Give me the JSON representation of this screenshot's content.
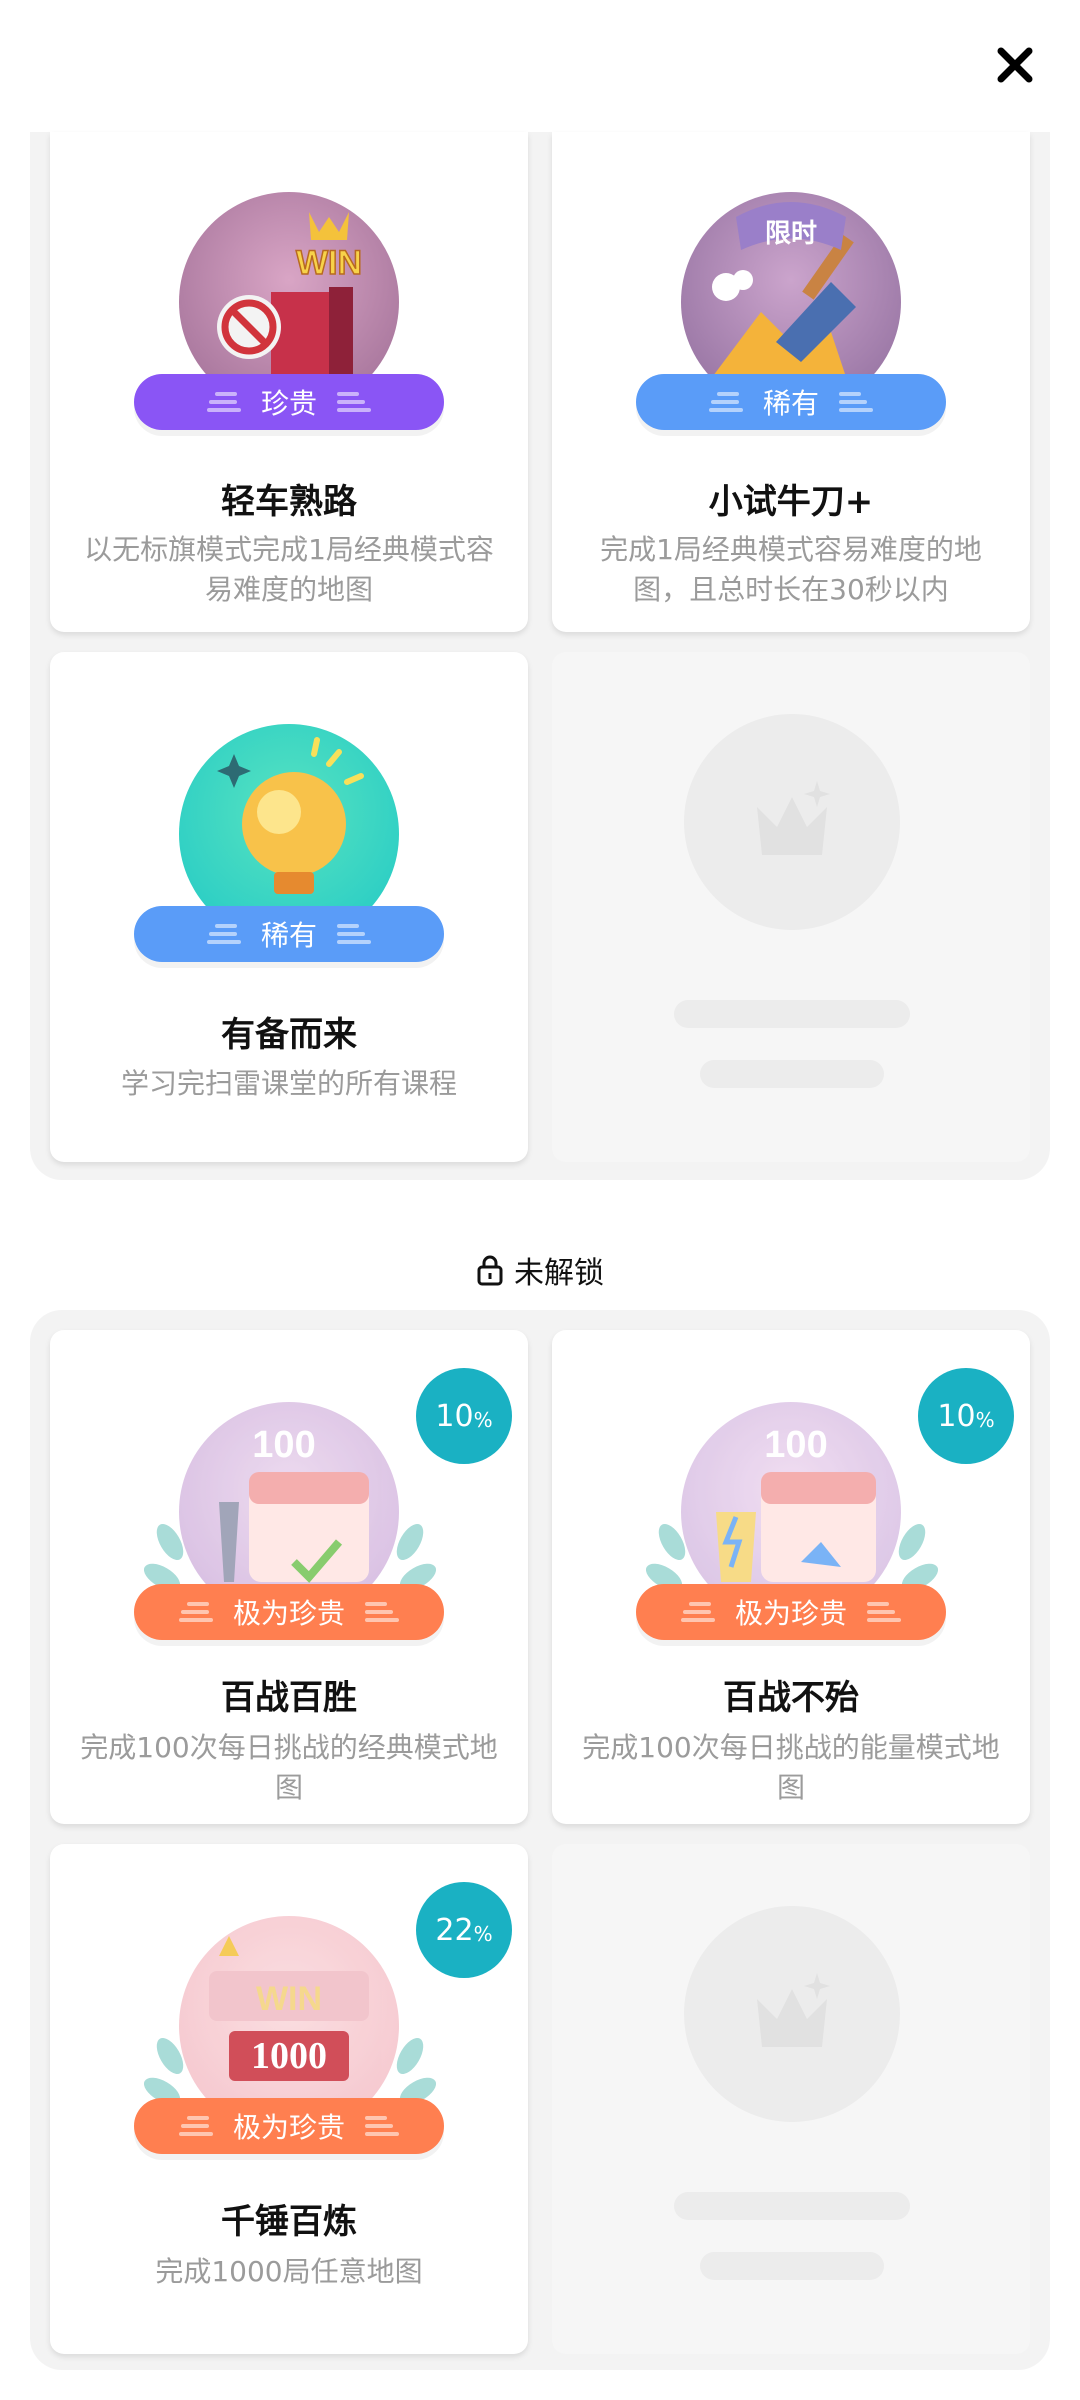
{
  "close_label": "✕",
  "top_cards": [
    {
      "title": "轻车熟路",
      "desc": "以无标旗模式完成1局经典模式容易难度的地图",
      "rarity": "珍贵",
      "rarity_color": "#8a55f5",
      "medal_text": "WIN"
    },
    {
      "title": "小试牛刀+",
      "desc": "完成1局经典模式容易难度的地图，且总时长在30秒以内",
      "rarity": "稀有",
      "rarity_color": "#5a9cf8",
      "medal_text": "限时"
    },
    {
      "title": "有备而来",
      "desc": "学习完扫雷课堂的所有课程",
      "rarity": "稀有",
      "rarity_color": "#5a9cf8"
    }
  ],
  "locked_section_label": "未解锁",
  "locked_cards": [
    {
      "title": "百战百胜",
      "desc": "完成100次每日挑战的经典模式地图",
      "rarity": "极为珍贵",
      "rarity_color": "#ff7f50",
      "progress": "10",
      "progress_unit": "%",
      "medal_text": "100"
    },
    {
      "title": "百战不殆",
      "desc": "完成100次每日挑战的能量模式地图",
      "rarity": "极为珍贵",
      "rarity_color": "#ff7f50",
      "progress": "10",
      "progress_unit": "%",
      "medal_text": "100"
    },
    {
      "title": "千锤百炼",
      "desc": "完成1000局任意地图",
      "rarity": "极为珍贵",
      "rarity_color": "#ff7f50",
      "progress": "22",
      "progress_unit": "%",
      "medal_text": "WIN",
      "medal_number": "1000"
    }
  ]
}
